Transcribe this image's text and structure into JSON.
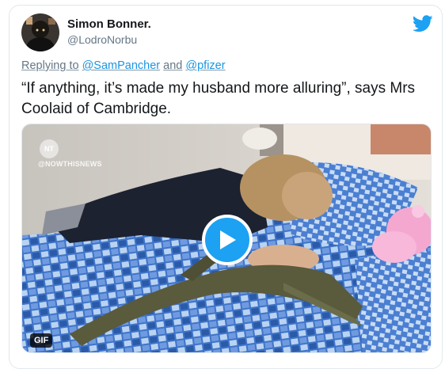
{
  "tweet": {
    "author_name": "Simon Bonner.",
    "author_handle": "@LodroNorbu",
    "reply_prefix": "Replying to",
    "reply_to_1": "@SamPancher",
    "reply_and": "and",
    "reply_to_2": "@pfizer",
    "text": "“If anything, it’s made my husband more alluring”, says Mrs Coolaid of Cambridge."
  },
  "media": {
    "watermark_logo": "NT",
    "watermark_handle": "@NOWTHISNEWS",
    "badge": "GIF"
  },
  "icons": {
    "brand": "twitter-bird-icon",
    "play": "play-icon",
    "brand_color": "#1da1f2"
  }
}
